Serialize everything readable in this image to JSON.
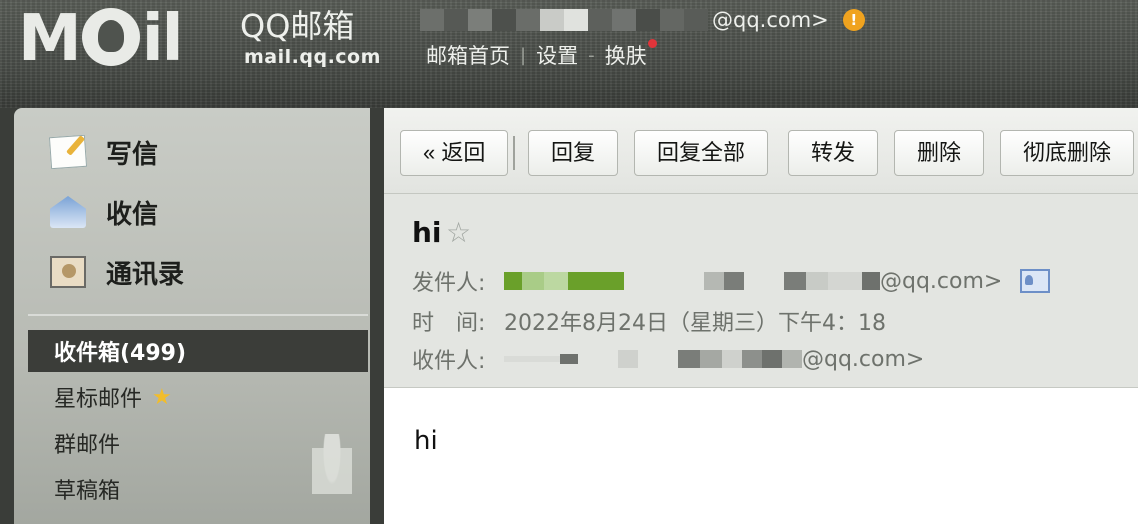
{
  "brand": {
    "logo_text": "M",
    "logo_text_end": "il",
    "name_cn": "QQ邮箱",
    "domain": "mail.qq.com"
  },
  "account": {
    "suffix": "@qq.com>",
    "warning_glyph": "!"
  },
  "topnav": {
    "home": "邮箱首页",
    "settings": "设置",
    "skin": "换肤",
    "separator": "|",
    "separator2": "-"
  },
  "sidebar": {
    "actions": [
      {
        "label": "写信",
        "icon": "compose-icon"
      },
      {
        "label": "收信",
        "icon": "inbox-envelope-icon"
      },
      {
        "label": "通讯录",
        "icon": "contacts-icon"
      }
    ],
    "folders": [
      {
        "label": "收件箱(499)",
        "active": true
      },
      {
        "label": "星标邮件",
        "icon": "star-icon"
      },
      {
        "label": "群邮件"
      },
      {
        "label": "草稿箱"
      }
    ],
    "star_glyph": "★"
  },
  "toolbar": {
    "back": "« 返回",
    "reply": "回复",
    "reply_all": "回复全部",
    "forward": "转发",
    "delete": "删除",
    "delete_permanent": "彻底删除"
  },
  "mail": {
    "subject": "hi",
    "star_glyph": "☆",
    "from_label": "发件人:",
    "from_suffix": "@qq.com>",
    "time_label": "时　间:",
    "time_value": "2022年8月24日（星期三）下午4：18",
    "to_label": "收件人:",
    "to_suffix": "@qq.com>",
    "body": "hi"
  },
  "colors": {
    "accent_green": "#6aa02a",
    "warning_orange": "#f0a31f",
    "active_folder_bg": "#3b3d39"
  }
}
